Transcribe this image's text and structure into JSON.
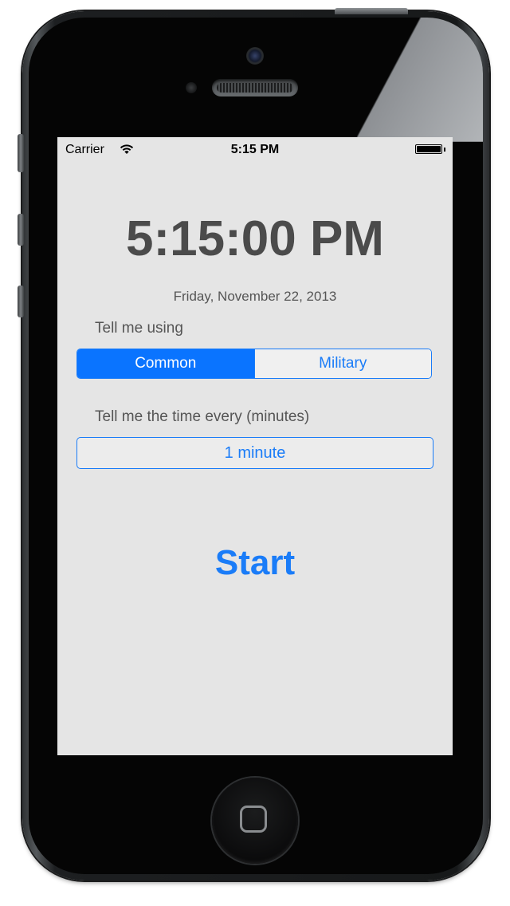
{
  "status_bar": {
    "carrier": "Carrier",
    "time": "5:15 PM"
  },
  "clock": {
    "time": "5:15:00 PM",
    "date": "Friday, November 22, 2013"
  },
  "format": {
    "label": "Tell me using",
    "options": [
      "Common",
      "Military"
    ],
    "selected": "Common"
  },
  "interval": {
    "label": "Tell me the time every (minutes)",
    "value": "1 minute"
  },
  "start": {
    "label": "Start"
  },
  "colors": {
    "accent": "#1a7cf8",
    "background": "#e5e5e5",
    "text": "#4b4b4b"
  }
}
